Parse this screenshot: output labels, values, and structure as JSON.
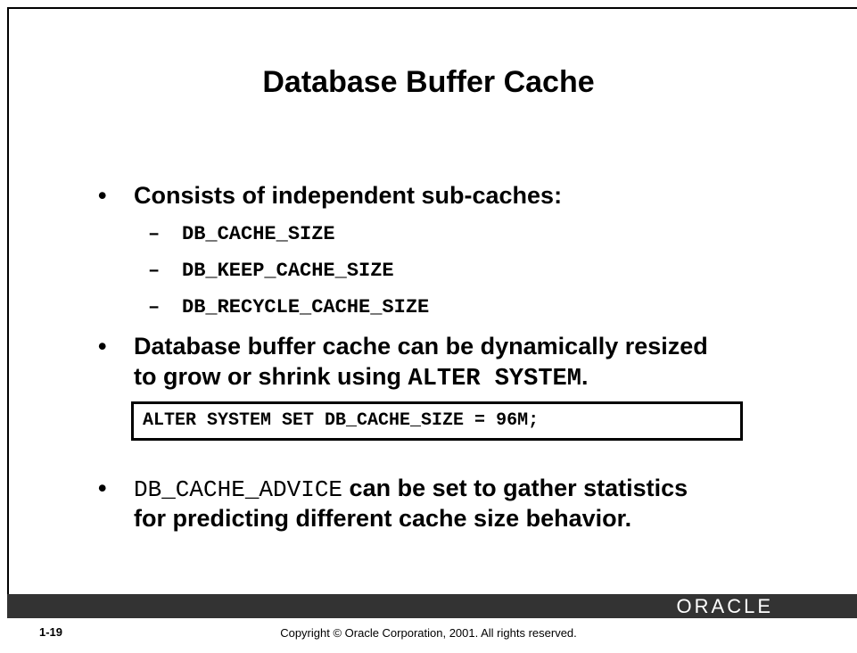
{
  "slide": {
    "title": "Database Buffer Cache",
    "bullets": [
      {
        "marker": "•",
        "text": "Consists of independent sub-caches:",
        "sub_items": [
          {
            "marker": "–",
            "text": "DB_CACHE_SIZE"
          },
          {
            "marker": "–",
            "text": "DB_KEEP_CACHE_SIZE"
          },
          {
            "marker": "–",
            "text": "DB_RECYCLE_CACHE_SIZE"
          }
        ]
      },
      {
        "marker": "•",
        "line1": "Database buffer cache can be dynamically resized",
        "line2_prefix": "to grow or shrink using ",
        "line2_code": "ALTER SYSTEM",
        "line2_suffix": "."
      },
      {
        "marker": "•",
        "line1_code": "DB_CACHE_ADVICE",
        "line1_text": " can be set to gather statistics",
        "line2": "for predicting different cache size behavior."
      }
    ],
    "code_example": "ALTER SYSTEM SET DB_CACHE_SIZE = 96M;"
  },
  "footer": {
    "logo": "ORACLE",
    "page_number": "1-19",
    "copyright": "Copyright © Oracle Corporation, 2001. All rights reserved."
  },
  "colors": {
    "footer_bar": "#333333",
    "background": "#ffffff",
    "text": "#000000"
  }
}
